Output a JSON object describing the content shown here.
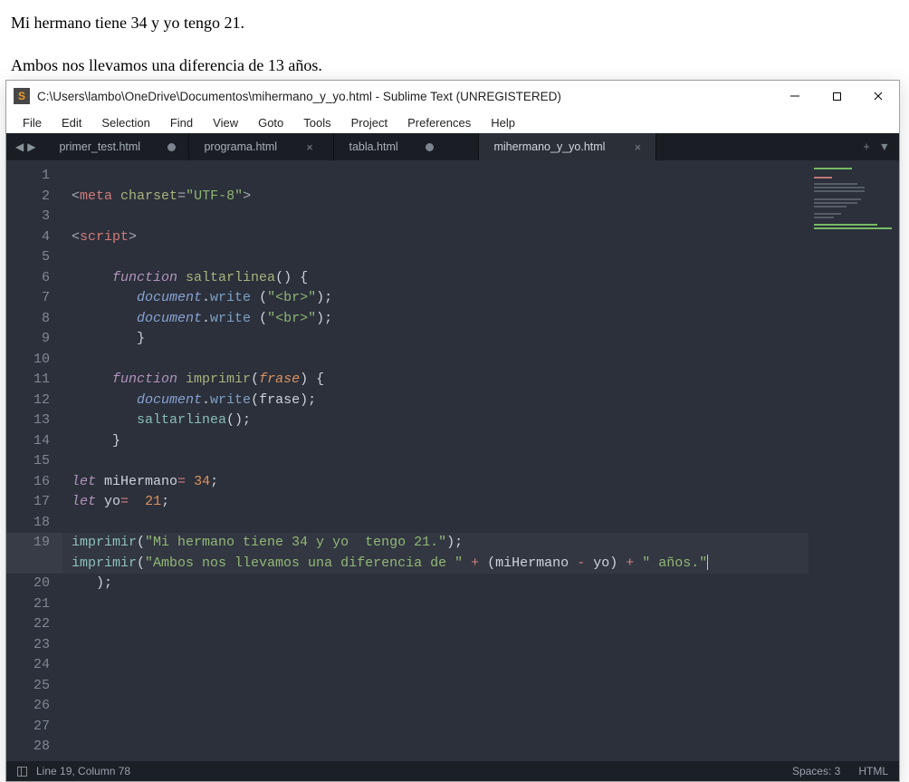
{
  "browser": {
    "line1": "Mi hermano tiene 34 y yo tengo 21.",
    "line2": "Ambos nos llevamos una diferencia de 13 años."
  },
  "window": {
    "title": "C:\\Users\\lambo\\OneDrive\\Documentos\\mihermano_y_yo.html - Sublime Text (UNREGISTERED)"
  },
  "menu": [
    "File",
    "Edit",
    "Selection",
    "Find",
    "View",
    "Goto",
    "Tools",
    "Project",
    "Preferences",
    "Help"
  ],
  "tabs": [
    {
      "label": "primer_test.html",
      "dirty": true,
      "active": false
    },
    {
      "label": "programa.html",
      "dirty": false,
      "active": false,
      "closeable": true
    },
    {
      "label": "tabla.html",
      "dirty": true,
      "active": false
    },
    {
      "label": "mihermano_y_yo.html",
      "dirty": false,
      "active": true,
      "closeable": true
    }
  ],
  "code": {
    "l1": {
      "meta": "meta",
      "charset_attr": "charset",
      "charset_val": "\"UTF-8\""
    },
    "l3": {
      "tag": "script"
    },
    "l5": {
      "kw": "function",
      "name": "saltarlinea"
    },
    "l6": {
      "obj": "document",
      "method": "write",
      "str": "\"<br>\""
    },
    "l7": {
      "obj": "document",
      "method": "write",
      "str": "\"<br>\""
    },
    "l10": {
      "kw": "function",
      "name": "imprimir",
      "param": "frase"
    },
    "l11": {
      "obj": "document",
      "method": "write",
      "arg": "frase"
    },
    "l12": {
      "fn": "saltarlinea"
    },
    "l15": {
      "let": "let",
      "name": "miHermano",
      "val": "34"
    },
    "l16": {
      "let": "let",
      "name": "yo",
      "val": "21"
    },
    "l18": {
      "fn": "imprimir",
      "str": "\"Mi hermano tiene 34 y yo  tengo 21.\""
    },
    "l19": {
      "fn": "imprimir",
      "str1": "\"Ambos nos llevamos una diferencia de \"",
      "var1": "miHermano",
      "var2": "yo",
      "str2": "\" años.\""
    }
  },
  "status": {
    "position": "Line 19, Column 78",
    "spaces": "Spaces: 3",
    "syntax": "HTML"
  }
}
